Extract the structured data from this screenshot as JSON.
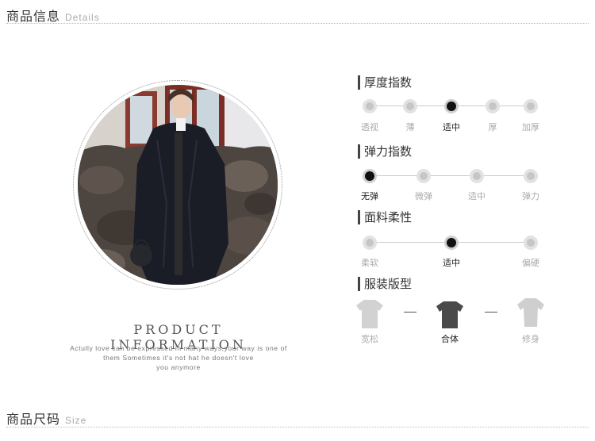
{
  "details_header": {
    "zh": "商品信息",
    "en": "Details"
  },
  "size_header": {
    "zh": "商品尺码",
    "en": "Size"
  },
  "product": {
    "title": "PRODUCT INFORMATION",
    "desc_lines": [
      "Actully love can be expressed in many ways,your way is one of",
      "them Sometimes it's not hat he doesn't love",
      "you anymore"
    ]
  },
  "indices": {
    "thickness": {
      "title": "厚度指数",
      "options": [
        "透视",
        "薄",
        "适中",
        "厚",
        "加厚"
      ],
      "selected": 2
    },
    "elasticity": {
      "title": "弹力指数",
      "options": [
        "无弹",
        "微弹",
        "适中",
        "弹力"
      ],
      "selected": 0
    },
    "softness": {
      "title": "面料柔性",
      "options": [
        "柔软",
        "适中",
        "偏硬"
      ],
      "selected": 1
    },
    "fit": {
      "title": "服装版型",
      "options": [
        "宽松",
        "合体",
        "修身"
      ],
      "selected": 1
    }
  },
  "colors": {
    "selected": "#111111",
    "unselected": "#c6c6c6",
    "text_muted": "#aaaaaa"
  }
}
